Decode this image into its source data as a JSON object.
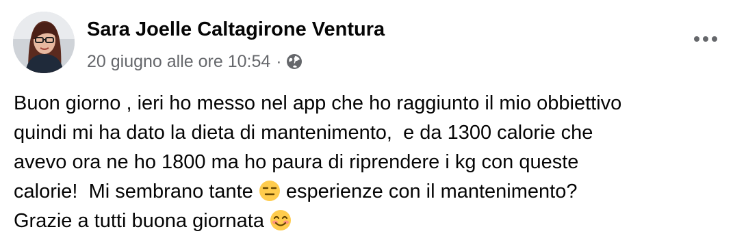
{
  "post": {
    "author_name": "Sara Joelle Caltagirone Ventura",
    "timestamp": "20 giugno alle ore 10:54",
    "separator": "·",
    "audience_icon": "globe-icon",
    "more_icon": "more-options-icon",
    "body_lines": [
      {
        "text": "Buon giorno , ieri ho messo nel app che ho raggiunto il mio obbiettivo"
      },
      {
        "text": "quindi mi ha dato la dieta di mantenimento,  e da 1300 calorie che"
      },
      {
        "text": "avevo ora ne ho 1800 ma ho paura di riprendere i kg con queste"
      },
      {
        "text": "calorie!  Mi sembrano tante ",
        "emoji": "expressionless-face-emoji",
        "after": " esperienze con il mantenimento?"
      },
      {
        "text": "Grazie a tutti buona giornata ",
        "emoji": "smiling-face-emoji"
      }
    ]
  },
  "colors": {
    "text": "#050505",
    "secondary_text": "#65676b",
    "background": "#ffffff",
    "emoji_yellow": "#ffcc4d"
  }
}
